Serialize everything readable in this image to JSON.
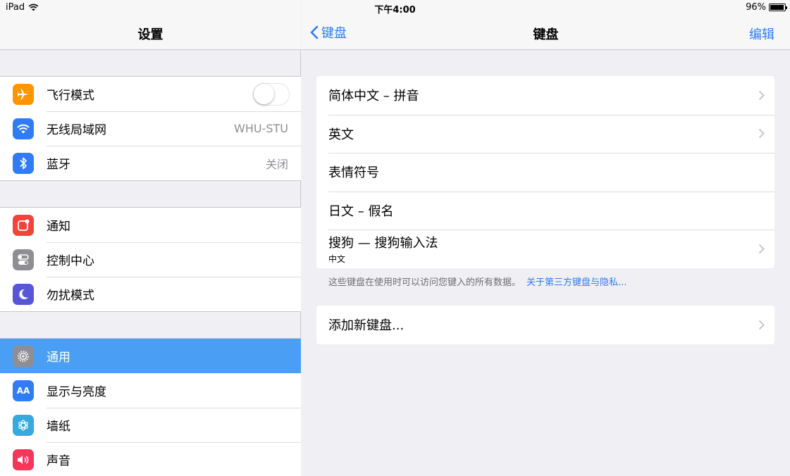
{
  "status_bar": {
    "device": "iPad",
    "time": "下午4:00",
    "battery_text": "96%",
    "battery_level": 0.96
  },
  "master": {
    "title": "设置",
    "groups": [
      [
        {
          "label": "飞行模式",
          "icon": "airplane-icon",
          "color": "#ff9500",
          "toggle": false
        },
        {
          "label": "无线局域网",
          "icon": "wifi-icon",
          "color": "#2f7cf6",
          "value": "WHU-STU"
        },
        {
          "label": "蓝牙",
          "icon": "bluetooth-icon",
          "color": "#2f7cf6",
          "value": "关闭"
        }
      ],
      [
        {
          "label": "通知",
          "icon": "notifications-icon",
          "color": "#f4443a"
        },
        {
          "label": "控制中心",
          "icon": "control-center-icon",
          "color": "#8e8e93"
        },
        {
          "label": "勿扰模式",
          "icon": "moon-icon",
          "color": "#5856d6"
        }
      ],
      [
        {
          "label": "通用",
          "icon": "gear-icon",
          "color": "#8e8e93",
          "selected": true
        },
        {
          "label": "显示与亮度",
          "icon": "display-brightness-icon",
          "color": "#2f7cf6",
          "glyph": "AA"
        },
        {
          "label": "墙纸",
          "icon": "wallpaper-icon",
          "color": "#36aadc"
        },
        {
          "label": "声音",
          "icon": "speaker-icon",
          "color": "#f4365b"
        }
      ]
    ]
  },
  "detail": {
    "back_label": "键盘",
    "title": "键盘",
    "edit_label": "编辑",
    "keyboards": [
      {
        "label": "简体中文 – 拼音",
        "chevron": true
      },
      {
        "label": "英文",
        "chevron": true
      },
      {
        "label": "表情符号",
        "chevron": false
      },
      {
        "label": "日文 – 假名",
        "chevron": false
      },
      {
        "label": "搜狗 — 搜狗输入法",
        "sub": "中文",
        "chevron": true
      }
    ],
    "footnote": "这些键盘在使用时可以访问您键入的所有数据。",
    "footnote_link": "关于第三方键盘与隐私...",
    "add_keyboard": "添加新键盘..."
  }
}
